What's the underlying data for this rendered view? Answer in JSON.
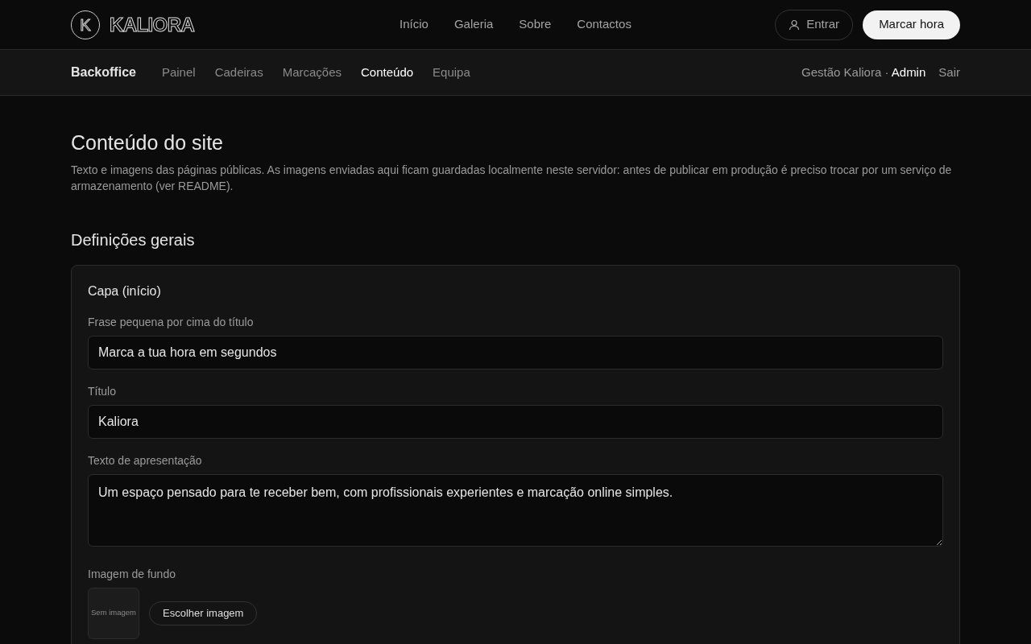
{
  "logo": {
    "mark": "K",
    "name": "KALIORA"
  },
  "nav": [
    {
      "label": "Início"
    },
    {
      "label": "Galeria"
    },
    {
      "label": "Sobre"
    },
    {
      "label": "Contactos"
    }
  ],
  "login_button": "Entrar",
  "cta_button": "Marcar hora",
  "backoffice": {
    "title": "Backoffice",
    "tabs": [
      {
        "label": "Painel",
        "selected": false
      },
      {
        "label": "Cadeiras",
        "selected": false
      },
      {
        "label": "Marcações",
        "selected": false
      },
      {
        "label": "Conteúdo",
        "selected": true
      },
      {
        "label": "Equipa",
        "selected": false
      }
    ],
    "user": "Gestão Kaliora · **Admin**",
    "logout": "Sair"
  },
  "page": {
    "title": "Conteúdo do site",
    "description": "Texto e imagens das páginas públicas. As imagens enviadas aqui ficam guardadas localmente neste servidor: antes de publicar em produção é preciso trocar por um serviço de armazenamento (ver README)."
  },
  "section_title": "Definições gerais",
  "card": {
    "title": "Capa (início)",
    "fields": [
      {
        "kind": "input",
        "label": "Frase pequena por cima do título",
        "value": "Marca a tua hora em segundos"
      },
      {
        "kind": "input",
        "label": "Título",
        "value": "Kaliora"
      },
      {
        "kind": "textarea",
        "label": "Texto de apresentação",
        "value": "Um espaço pensado para te receber bem, com profissionais experientes e marcação online simples."
      },
      {
        "kind": "image",
        "label": "Imagem de fundo",
        "empty_text": "Sem imagem",
        "button": "Escolher imagem"
      }
    ]
  }
}
